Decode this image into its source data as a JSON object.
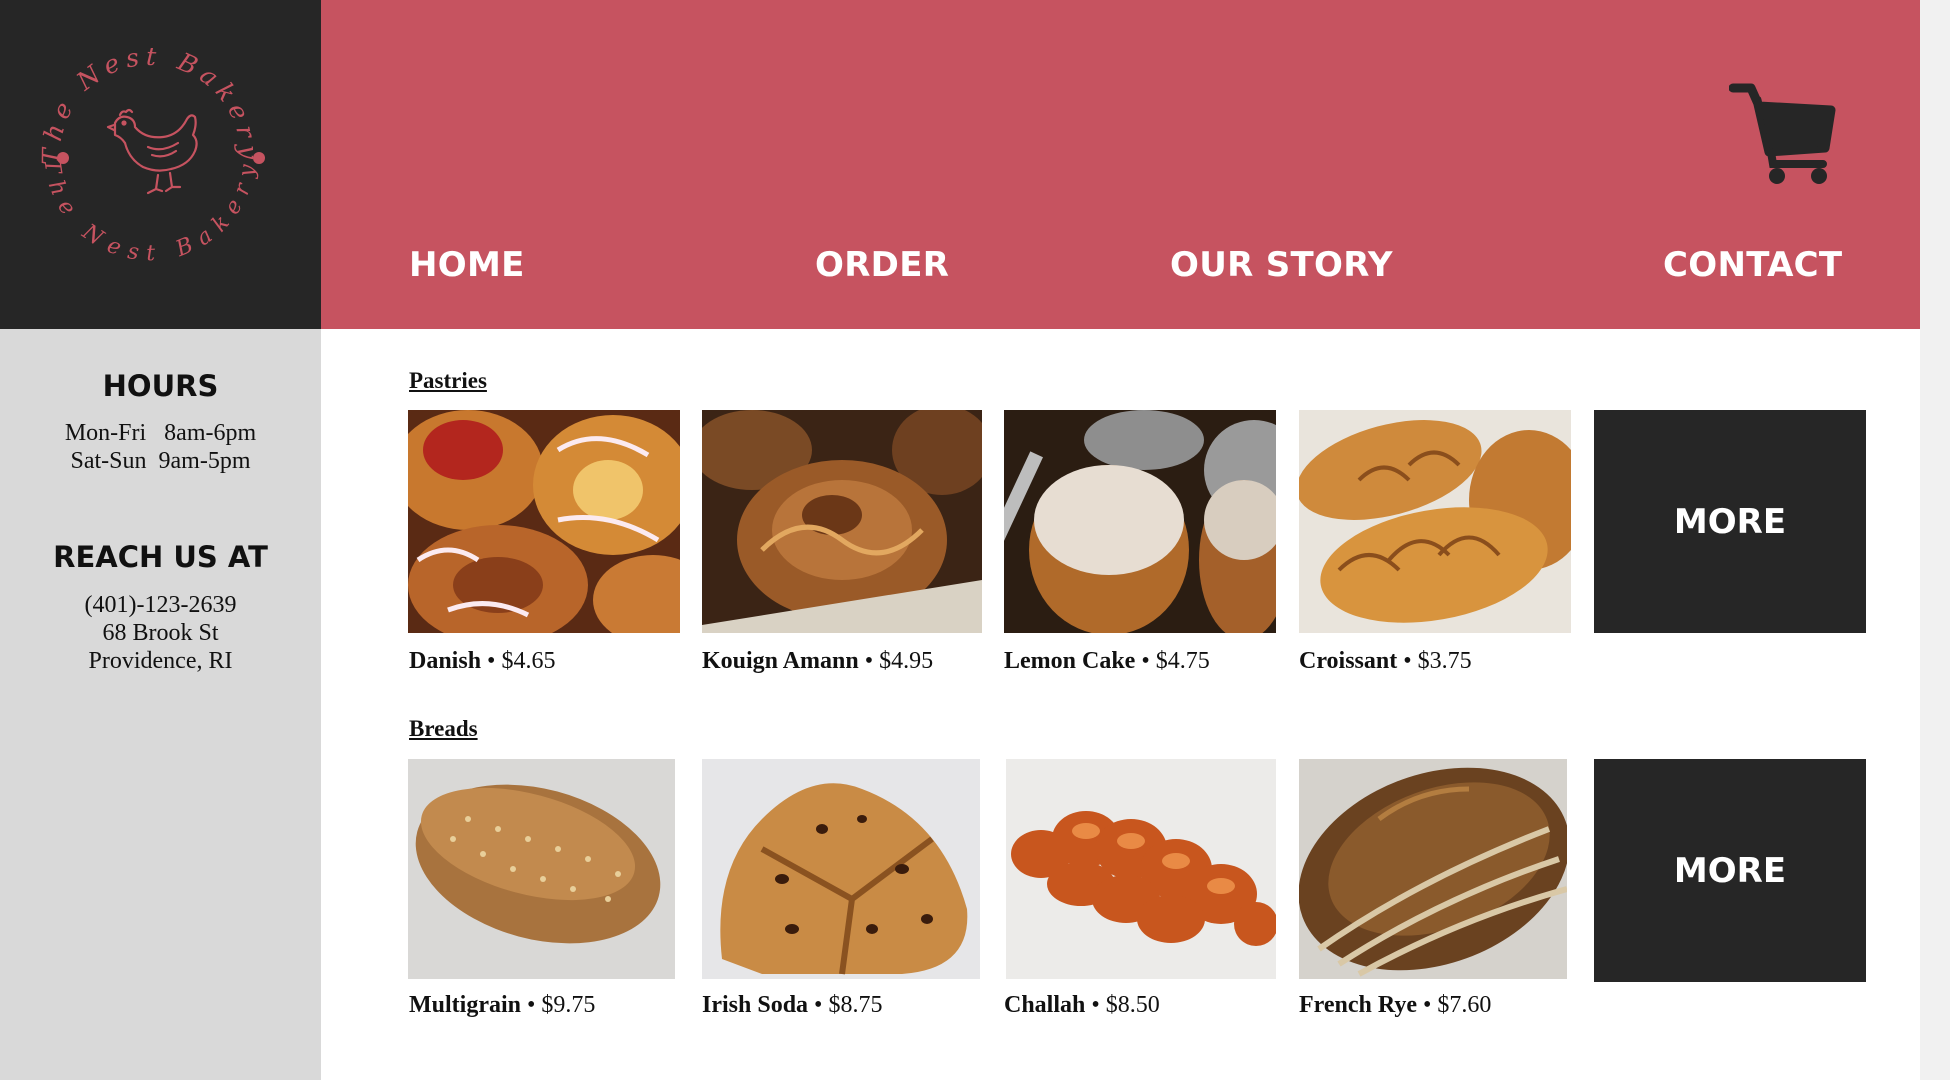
{
  "brand": {
    "logo_text_top": "The Nest Bakery",
    "logo_text_bottom": "The Nest Bakery",
    "logo_icon": "hen-icon",
    "accent_color": "#c65360",
    "dark_color": "#262626"
  },
  "nav": {
    "items": [
      {
        "label": "HOME"
      },
      {
        "label": "ORDER"
      },
      {
        "label": "OUR STORY"
      },
      {
        "label": "CONTACT"
      }
    ],
    "cart_icon": "shopping-cart-icon"
  },
  "sidebar": {
    "hours_heading": "HOURS",
    "hours": [
      "Mon-Fri   8am-6pm",
      "Sat-Sun  9am-5pm"
    ],
    "reach_heading": "REACH US AT",
    "contact": [
      "(401)-123-2639",
      "68 Brook St",
      "Providence, RI"
    ]
  },
  "sections": [
    {
      "title": "Pastries",
      "more_label": "MORE",
      "products": [
        {
          "name": "Danish",
          "price": "•  $4.65"
        },
        {
          "name": "Kouign Amann",
          "price": "•  $4.95"
        },
        {
          "name": "Lemon Cake",
          "price": "• $4.75"
        },
        {
          "name": "Croissant",
          "price": "•  $3.75"
        }
      ]
    },
    {
      "title": "Breads",
      "more_label": "MORE",
      "products": [
        {
          "name": "Multigrain",
          "price": "•  $9.75"
        },
        {
          "name": "Irish Soda",
          "price": "•  $8.75"
        },
        {
          "name": "Challah",
          "price": "•  $8.50"
        },
        {
          "name": "French Rye",
          "price": "•  $7.60"
        }
      ]
    }
  ]
}
